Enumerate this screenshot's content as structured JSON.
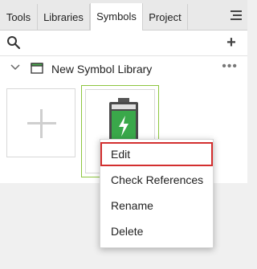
{
  "tabs": [
    {
      "label": "Tools"
    },
    {
      "label": "Libraries"
    },
    {
      "label": "Symbols"
    },
    {
      "label": "Project"
    }
  ],
  "active_tab": "Symbols",
  "toolbar": {
    "search_icon": "search-icon",
    "add_icon": "plus-icon"
  },
  "library": {
    "name": "New Symbol Library",
    "expanded": true
  },
  "symbols": [
    {
      "type": "add-symbol",
      "icon": "plus-icon"
    },
    {
      "type": "symbol",
      "icon": "battery-charging-icon",
      "selected": true
    }
  ],
  "context_menu": {
    "items": [
      {
        "label": "Edit",
        "highlighted": true
      },
      {
        "label": "Check References"
      },
      {
        "label": "Rename"
      },
      {
        "label": "Delete"
      }
    ]
  },
  "colors": {
    "selection_border": "#8dc63f",
    "highlight_border": "#d32f2f",
    "battery_green": "#3aa84a"
  }
}
